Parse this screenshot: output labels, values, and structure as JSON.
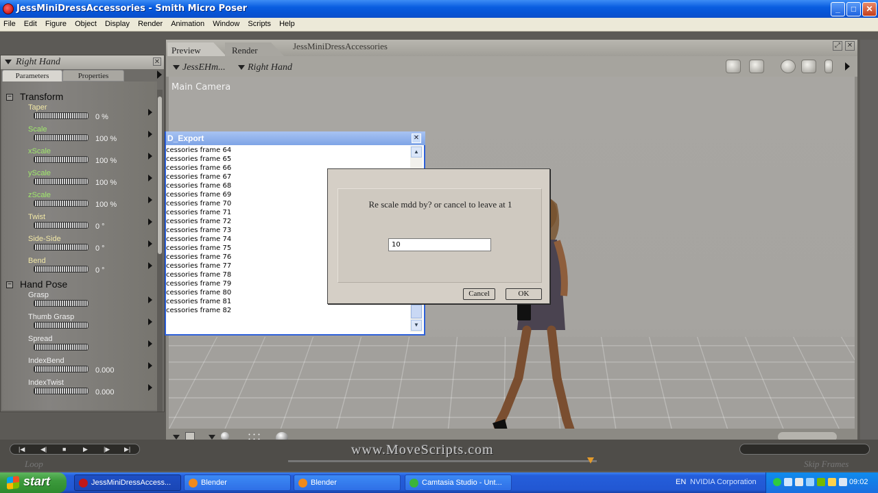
{
  "window": {
    "title": "JessMiniDressAccessories - Smith Micro Poser",
    "min": "_",
    "max": "□",
    "close": "✕"
  },
  "menu": [
    "File",
    "Edit",
    "Figure",
    "Object",
    "Display",
    "Render",
    "Animation",
    "Window",
    "Scripts",
    "Help"
  ],
  "left_panel": {
    "title": "Right Hand",
    "close": "✕",
    "tabs": [
      "Parameters",
      "Properties"
    ],
    "groups": [
      {
        "label": "Transform"
      },
      {
        "label": "Hand Pose"
      }
    ],
    "params": [
      {
        "name": "Taper",
        "value": "0 %"
      },
      {
        "name": "Scale",
        "value": "100 %"
      },
      {
        "name": "xScale",
        "value": "100 %"
      },
      {
        "name": "yScale",
        "value": "100 %"
      },
      {
        "name": "zScale",
        "value": "100 %"
      },
      {
        "name": "Twist",
        "value": "0 °"
      },
      {
        "name": "Side-Side",
        "value": "0 °"
      },
      {
        "name": "Bend",
        "value": "0 °"
      },
      {
        "name": "Grasp",
        "value": ""
      },
      {
        "name": "Thumb Grasp",
        "value": ""
      },
      {
        "name": "Spread",
        "value": ""
      },
      {
        "name": "IndexBend",
        "value": "0.000"
      },
      {
        "name": "IndexTwist",
        "value": "0.000"
      }
    ]
  },
  "document": {
    "tabs": [
      "Preview",
      "Render"
    ],
    "title": "JessMiniDressAccessories",
    "figure_select": "JessEHm...",
    "actor_select": "Right Hand",
    "camera_label": "Main Camera"
  },
  "export_window": {
    "title": "D_Export",
    "close": "✕",
    "lines": [
      "cessories frame  64",
      "cessories frame  65",
      "cessories frame  66",
      "cessories frame  67",
      "cessories frame  68",
      "cessories frame  69",
      "cessories frame  70",
      "cessories frame  71",
      "cessories frame  72",
      "cessories frame  73",
      "cessories frame  74",
      "cessories frame  75",
      "cessories frame  76",
      "cessories frame  77",
      "cessories frame  78",
      "cessories frame  79",
      "cessories frame  80",
      "cessories frame  81",
      "cessories frame  82"
    ]
  },
  "dialog": {
    "message": "Re scale mdd by? or cancel to leave at 1",
    "input_value": "10",
    "cancel": "Cancel",
    "ok": "OK"
  },
  "animation": {
    "loop": "Loop",
    "skip_frames": "Skip Frames",
    "watermark": "www.MoveScripts.com"
  },
  "taskbar": {
    "start": "start",
    "tasks": [
      {
        "label": "JessMiniDressAccess...",
        "color": "#c01818"
      },
      {
        "label": "Blender",
        "color": "#f08a1c"
      },
      {
        "label": "Blender",
        "color": "#f08a1c"
      },
      {
        "label": "Camtasia Studio - Unt...",
        "color": "#3bb43b"
      }
    ],
    "lang": "EN",
    "tray_text": "NVIDIA Corporation",
    "clock": "09:02"
  }
}
